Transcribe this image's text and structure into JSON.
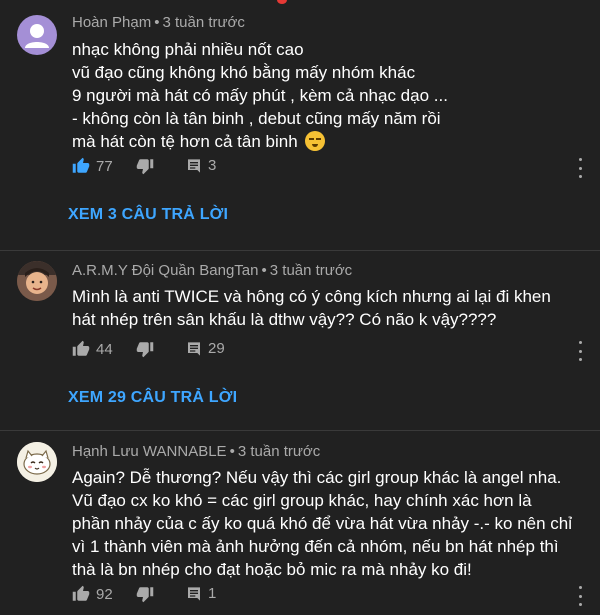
{
  "comments": [
    {
      "author": "Hoàn Phạm",
      "time": "3 tuần trước",
      "lines": [
        "nhạc không phải nhiều nốt cao",
        "vũ đạo cũng không khó bằng mấy nhóm khác",
        "9 người mà hát có mấy phút , kèm cả nhạc dạo ...",
        "- không còn là tân binh , debut cũng mấy năm rồi",
        "mà hát còn tệ hơn cả tân binh"
      ],
      "likes": "77",
      "replies": "3",
      "view_replies": "XEM 3 CÂU TRẢ LỜI"
    },
    {
      "author": "A.R.M.Y Đội Quần BangTan",
      "time": "3 tuần trước",
      "lines": [
        "Mình là anti TWICE và hông có ý công kích nhưng ai lại đi khen",
        "hát nhép trên sân khấu là dthw vậy?? Có não k vậy????"
      ],
      "likes": "44",
      "replies": "29",
      "view_replies": "XEM 29 CÂU TRẢ LỜI"
    },
    {
      "author": "Hạnh Lưu WANNABLE",
      "time": "3 tuần trước",
      "lines": [
        "Again? Dễ thương? Nếu vậy thì các girl group khác là angel nha.",
        "Vũ đạo cx ko khó = các girl group khác, hay chính xác hơn là",
        "phần nhảy của c ấy ko quá khó để vừa hát vừa nhảy -.- ko nên chỉ",
        "vì 1 thành viên mà ảnh hưởng đến cả nhóm, nếu bn hát nhép thì",
        "thà là bn nhép cho đạt hoặc bỏ mic ra mà nhảy ko đi!"
      ],
      "likes": "92",
      "replies": "1"
    }
  ],
  "separator": "•",
  "colors": {
    "background": "#212121",
    "link": "#3ea6ff",
    "secondary_text": "#aaaaaa",
    "avatar_purple": "#a48fd6"
  }
}
